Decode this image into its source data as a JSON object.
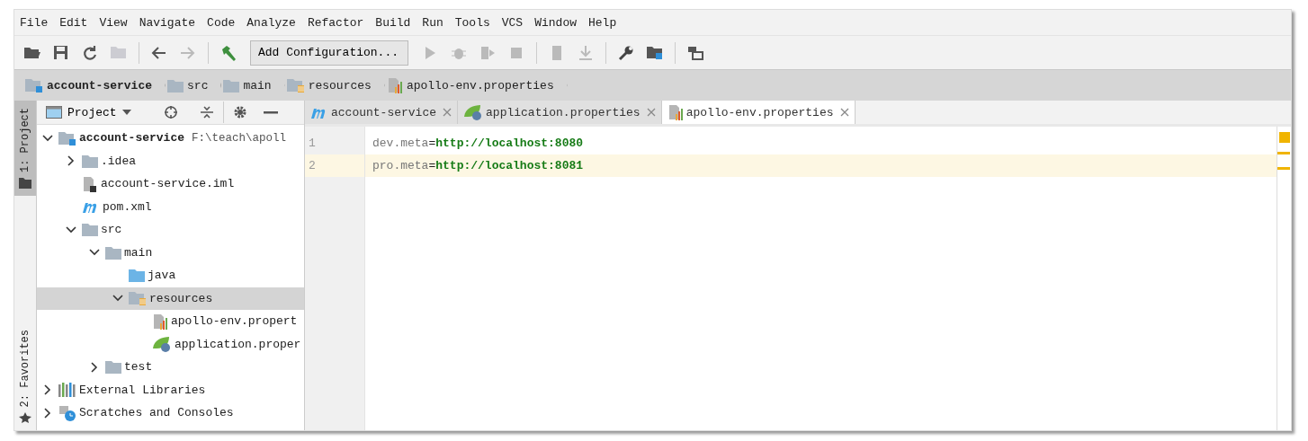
{
  "menu": [
    "File",
    "Edit",
    "View",
    "Navigate",
    "Code",
    "Analyze",
    "Refactor",
    "Build",
    "Run",
    "Tools",
    "VCS",
    "Window",
    "Help"
  ],
  "toolbar": [
    {
      "kind": "button",
      "enabled": true
    },
    {
      "kind": "button",
      "enabled": true
    },
    {
      "kind": "button",
      "enabled": true
    },
    {
      "kind": "button",
      "enabled": false
    },
    {
      "kind": "separator"
    },
    {
      "kind": "button",
      "enabled": true
    },
    {
      "kind": "button",
      "enabled": false
    },
    {
      "kind": "separator"
    },
    {
      "kind": "button",
      "enabled": true
    },
    {
      "kind": "dropdown",
      "label": "Add Configuration..."
    },
    {
      "kind": "button",
      "enabled": false
    },
    {
      "kind": "button",
      "enabled": false
    },
    {
      "kind": "button",
      "enabled": false
    },
    {
      "kind": "button",
      "enabled": false
    },
    {
      "kind": "separator"
    },
    {
      "kind": "button",
      "enabled": false
    },
    {
      "kind": "button",
      "enabled": false
    },
    {
      "kind": "separator"
    },
    {
      "kind": "button",
      "enabled": true
    },
    {
      "kind": "button",
      "enabled": true
    },
    {
      "kind": "separator"
    },
    {
      "kind": "button",
      "enabled": true
    }
  ],
  "breadcrumbs": [
    {
      "label": "account-service",
      "kind": "module"
    },
    {
      "label": "src",
      "kind": "folder"
    },
    {
      "label": "main",
      "kind": "folder"
    },
    {
      "label": "resources",
      "kind": "resources"
    },
    {
      "label": "apollo-env.properties",
      "kind": "properties"
    }
  ],
  "side_tabs": [
    {
      "label": "1: Project",
      "selected": true
    },
    {
      "label": "2: Favorites",
      "selected": false
    }
  ],
  "project_panel": {
    "title": "Project",
    "tree": [
      {
        "label": "account-service",
        "path": "F:\\teach\\apoll",
        "kind": "module",
        "expanded": true,
        "selected": false,
        "children": [
          {
            "label": ".idea",
            "kind": "folder",
            "expanded": false,
            "selected": false
          },
          {
            "label": "account-service.iml",
            "kind": "iml",
            "selected": false
          },
          {
            "label": "pom.xml",
            "kind": "maven",
            "selected": false
          },
          {
            "label": "src",
            "kind": "folder",
            "expanded": true,
            "selected": false,
            "children": [
              {
                "label": "main",
                "kind": "folder",
                "expanded": true,
                "selected": false,
                "children": [
                  {
                    "label": "java",
                    "kind": "source",
                    "selected": false
                  },
                  {
                    "label": "resources",
                    "kind": "resources",
                    "expanded": true,
                    "selected": true,
                    "children": [
                      {
                        "label": "apollo-env.propert",
                        "kind": "properties",
                        "selected": false
                      },
                      {
                        "label": "application.proper",
                        "kind": "spring",
                        "selected": false
                      }
                    ]
                  }
                ]
              },
              {
                "label": "test",
                "kind": "folder",
                "expanded": false,
                "selected": false
              }
            ]
          }
        ]
      },
      {
        "label": "External Libraries",
        "kind": "libraries",
        "expanded": false,
        "selected": false
      },
      {
        "label": "Scratches and Consoles",
        "kind": "scratches",
        "expanded": false,
        "selected": false
      }
    ]
  },
  "editor_tabs": [
    {
      "label": "account-service",
      "kind": "maven",
      "selected": false
    },
    {
      "label": "application.properties",
      "kind": "spring",
      "selected": false
    },
    {
      "label": "apollo-env.properties",
      "kind": "properties",
      "selected": true
    }
  ],
  "editor": {
    "lines": [
      {
        "number": "1",
        "key": "dev.meta",
        "sep": "=",
        "value": "http://localhost:8080",
        "current": false
      },
      {
        "number": "2",
        "key": "pro.meta",
        "sep": "=",
        "value": "http://localhost:8081",
        "current": true
      }
    ]
  }
}
